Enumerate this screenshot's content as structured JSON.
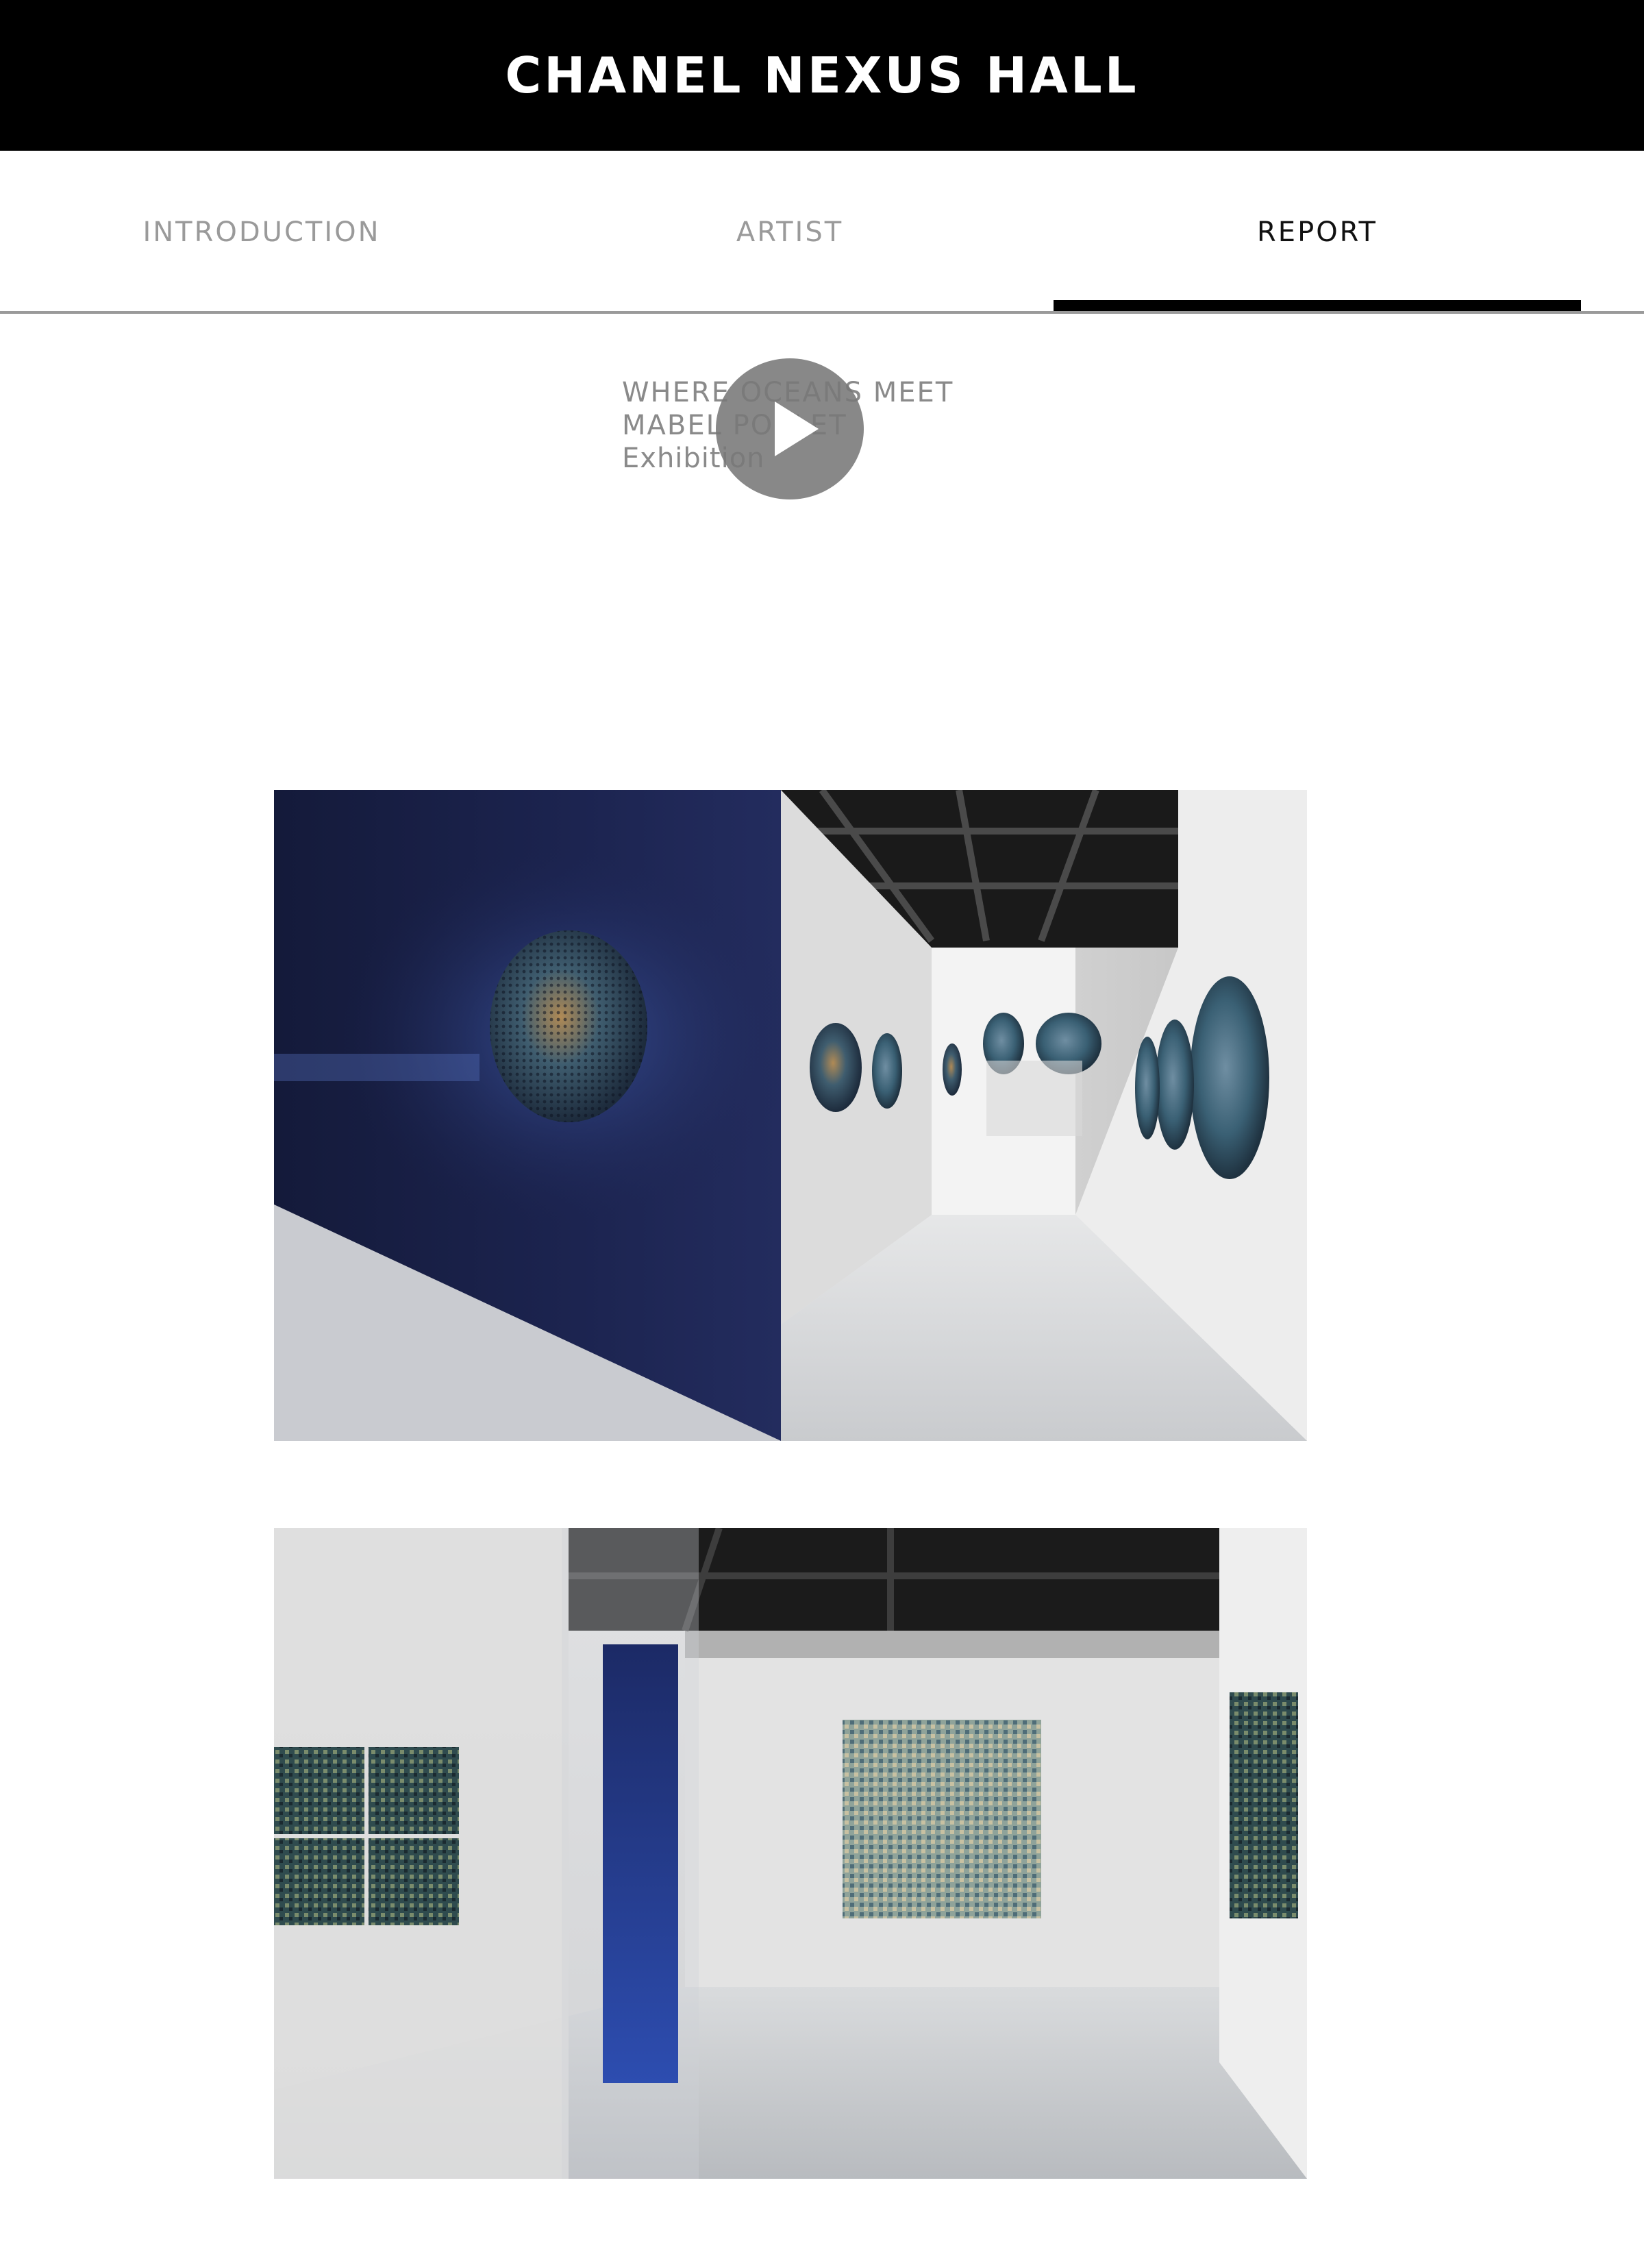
{
  "header": {
    "brand": "CHANEL NEXUS HALL"
  },
  "tabs": [
    {
      "label": "INTRODUCTION",
      "active": false
    },
    {
      "label": "ARTIST",
      "active": false
    },
    {
      "label": "REPORT",
      "active": true
    }
  ],
  "video": {
    "title_line1": "WHERE OCEANS MEET",
    "title_line2": "MABEL POBLET",
    "title_line3": "Exhibition",
    "play_icon": "play-icon"
  },
  "photos": [
    {
      "name": "exhibition-photo-hallway",
      "description_icon": "photo"
    },
    {
      "name": "exhibition-photo-room",
      "description_icon": "photo"
    }
  ],
  "colors": {
    "header_bg": "#000000",
    "active_tab": "#111111",
    "inactive_tab": "#9a9a9a"
  }
}
